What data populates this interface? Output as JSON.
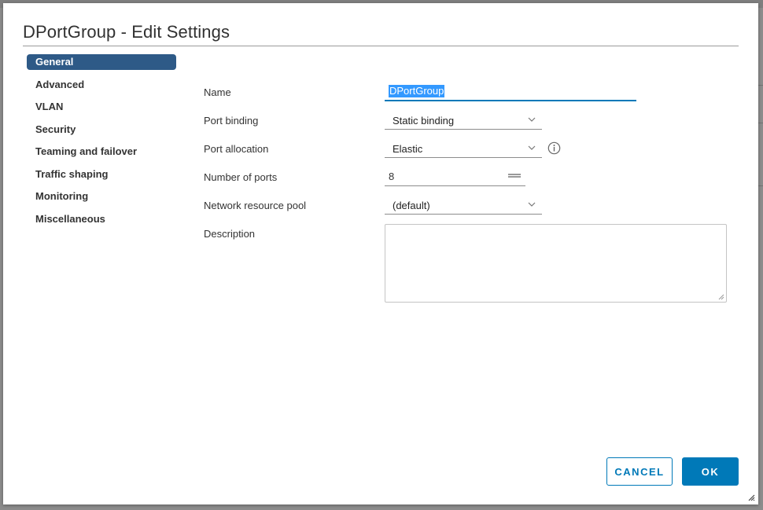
{
  "dialog": {
    "title": "DPortGroup - Edit Settings"
  },
  "nav": {
    "items": [
      {
        "label": "General",
        "active": true
      },
      {
        "label": "Advanced",
        "active": false
      },
      {
        "label": "VLAN",
        "active": false
      },
      {
        "label": "Security",
        "active": false
      },
      {
        "label": "Teaming and failover",
        "active": false
      },
      {
        "label": "Traffic shaping",
        "active": false
      },
      {
        "label": "Monitoring",
        "active": false
      },
      {
        "label": "Miscellaneous",
        "active": false
      }
    ]
  },
  "form": {
    "name": {
      "label": "Name",
      "value": "DPortGroup"
    },
    "port_binding": {
      "label": "Port binding",
      "value": "Static binding"
    },
    "port_allocation": {
      "label": "Port allocation",
      "value": "Elastic"
    },
    "number_of_ports": {
      "label": "Number of ports",
      "value": "8"
    },
    "network_resource_pool": {
      "label": "Network resource pool",
      "value": "(default)"
    },
    "description": {
      "label": "Description",
      "value": ""
    }
  },
  "buttons": {
    "cancel": "CANCEL",
    "ok": "OK"
  },
  "colors": {
    "accent": "#0079b8",
    "nav_active": "#2e5a87",
    "selection": "#3399ff"
  },
  "icons": {
    "info": "info-circle-icon",
    "chevron": "chevron-down-icon",
    "stepper": "stepper-icon",
    "resize": "resize-grip-icon"
  }
}
